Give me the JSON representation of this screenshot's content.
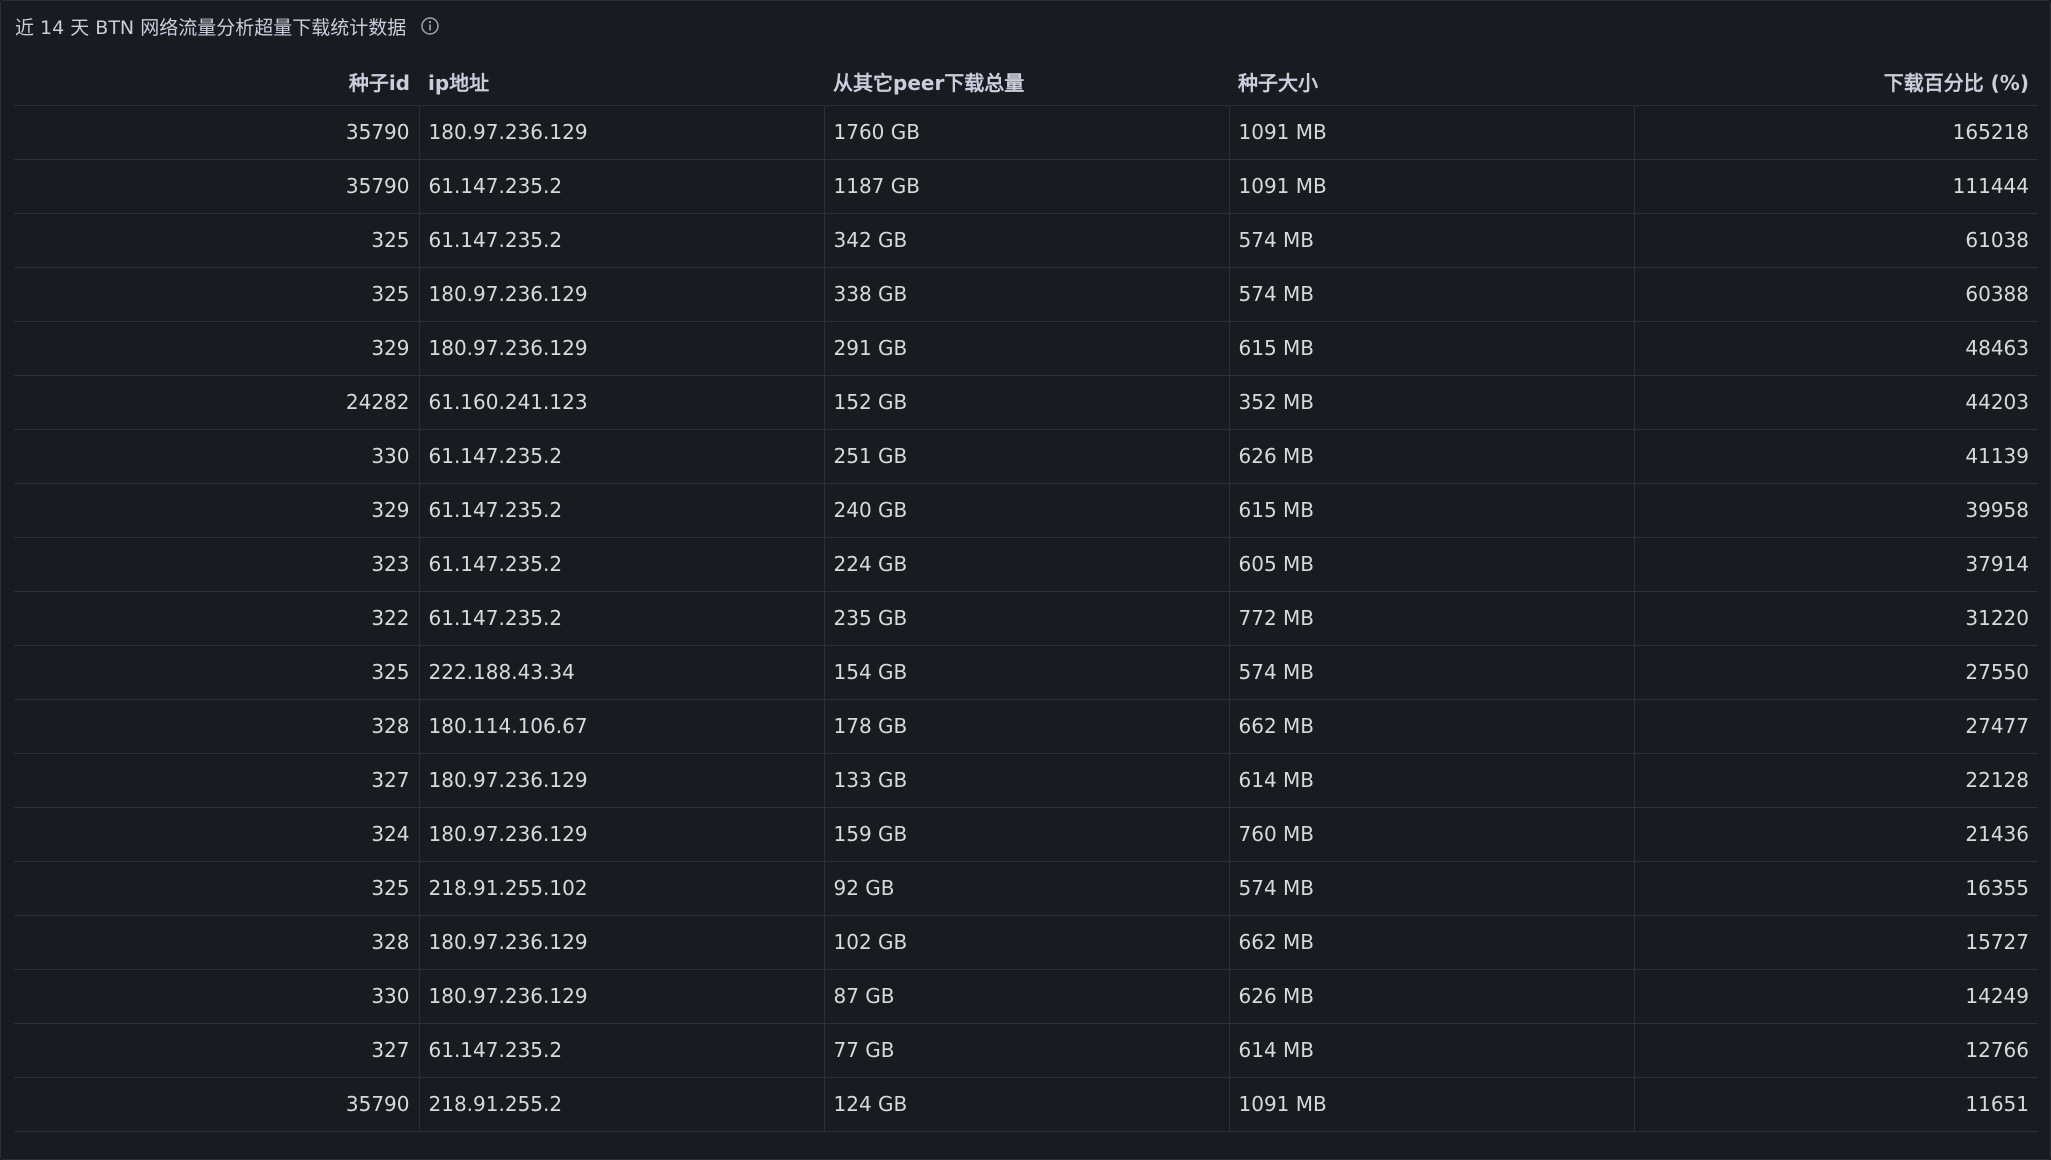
{
  "panel": {
    "title": "近 14 天 BTN 网络流量分析超量下载统计数据",
    "info_icon": "info-circle-icon"
  },
  "table": {
    "columns": [
      {
        "label": "种子id",
        "align": "right"
      },
      {
        "label": "ip地址",
        "align": "left"
      },
      {
        "label": "从其它peer下载总量",
        "align": "left"
      },
      {
        "label": "种子大小",
        "align": "left"
      },
      {
        "label": "下载百分比 (%)",
        "align": "right"
      }
    ],
    "rows": [
      [
        "35790",
        "180.97.236.129",
        "1760 GB",
        "1091 MB",
        "165218"
      ],
      [
        "35790",
        "61.147.235.2",
        "1187 GB",
        "1091 MB",
        "111444"
      ],
      [
        "325",
        "61.147.235.2",
        "342 GB",
        "574 MB",
        "61038"
      ],
      [
        "325",
        "180.97.236.129",
        "338 GB",
        "574 MB",
        "60388"
      ],
      [
        "329",
        "180.97.236.129",
        "291 GB",
        "615 MB",
        "48463"
      ],
      [
        "24282",
        "61.160.241.123",
        "152 GB",
        "352 MB",
        "44203"
      ],
      [
        "330",
        "61.147.235.2",
        "251 GB",
        "626 MB",
        "41139"
      ],
      [
        "329",
        "61.147.235.2",
        "240 GB",
        "615 MB",
        "39958"
      ],
      [
        "323",
        "61.147.235.2",
        "224 GB",
        "605 MB",
        "37914"
      ],
      [
        "322",
        "61.147.235.2",
        "235 GB",
        "772 MB",
        "31220"
      ],
      [
        "325",
        "222.188.43.34",
        "154 GB",
        "574 MB",
        "27550"
      ],
      [
        "328",
        "180.114.106.67",
        "178 GB",
        "662 MB",
        "27477"
      ],
      [
        "327",
        "180.97.236.129",
        "133 GB",
        "614 MB",
        "22128"
      ],
      [
        "324",
        "180.97.236.129",
        "159 GB",
        "760 MB",
        "21436"
      ],
      [
        "325",
        "218.91.255.102",
        "92 GB",
        "574 MB",
        "16355"
      ],
      [
        "328",
        "180.97.236.129",
        "102 GB",
        "662 MB",
        "15727"
      ],
      [
        "330",
        "180.97.236.129",
        "87 GB",
        "626 MB",
        "14249"
      ],
      [
        "327",
        "61.147.235.2",
        "77 GB",
        "614 MB",
        "12766"
      ],
      [
        "35790",
        "218.91.255.2",
        "124 GB",
        "1091 MB",
        "11651"
      ]
    ]
  },
  "colors": {
    "panel_bg": "#181b1f",
    "border": "#2c3036",
    "text": "#d8d9da",
    "header_text": "#ccccdc"
  }
}
